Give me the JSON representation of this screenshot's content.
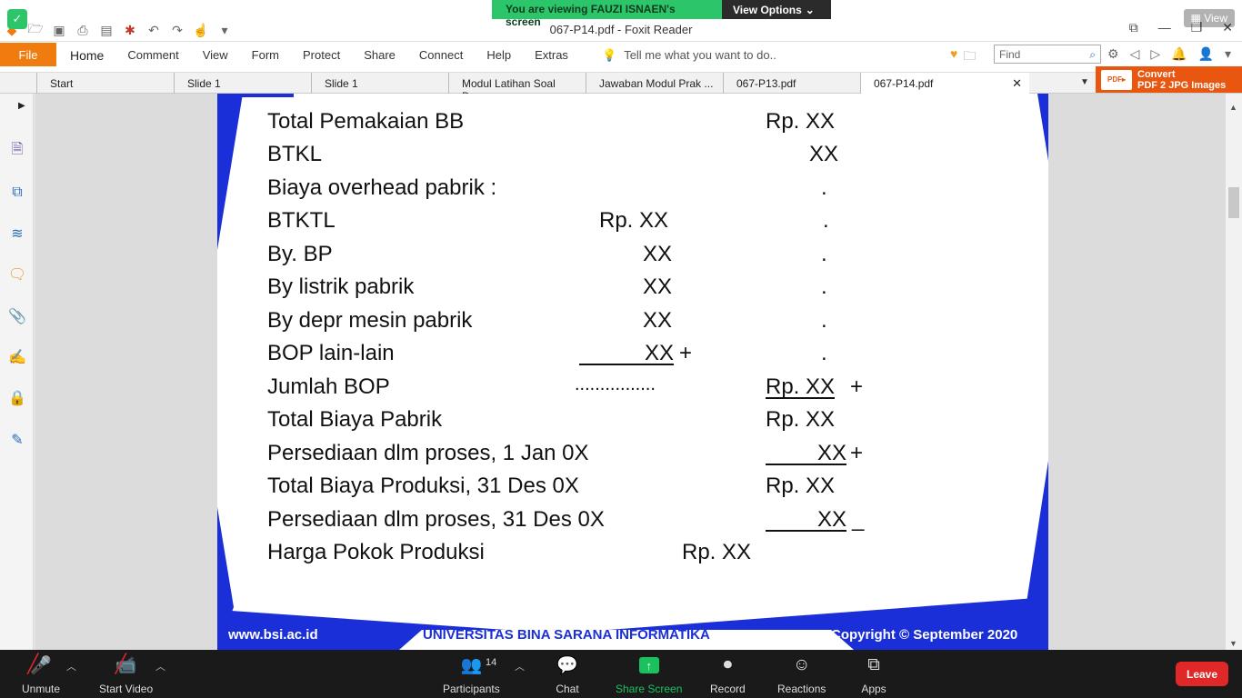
{
  "zoom": {
    "banner_viewing": "You are viewing FAUZI ISNAEN's screen",
    "view_options": "View Options",
    "view_top_right": "View",
    "participants_count": "14",
    "toolbar": {
      "unmute": "Unmute",
      "start_video": "Start Video",
      "participants": "Participants",
      "chat": "Chat",
      "share_screen": "Share Screen",
      "record": "Record",
      "reactions": "Reactions",
      "apps": "Apps",
      "leave": "Leave"
    }
  },
  "app": {
    "title": "067-P14.pdf - Foxit Reader"
  },
  "ribbon": {
    "file": "File",
    "tabs": [
      "Home",
      "Comment",
      "View",
      "Form",
      "Protect",
      "Share",
      "Connect",
      "Help",
      "Extras"
    ],
    "tell_me": "Tell me what you want to do..",
    "find_placeholder": "Find"
  },
  "doc_tabs": [
    "Start",
    "Slide 1",
    "Slide 1",
    "Modul Latihan Soal Da...",
    "Jawaban Modul Prak ...",
    "067-P13.pdf",
    "067-P14.pdf"
  ],
  "convert": {
    "line1": "Convert",
    "line2": "PDF 2 JPG Images"
  },
  "document": {
    "lines": [
      {
        "label": "Total Pemakaian BB",
        "mid": "",
        "right": "Rp. XX",
        "suffix": ""
      },
      {
        "label": "BTKL",
        "mid": "",
        "right": "XX",
        "suffix": ""
      },
      {
        "label": "Biaya overhead pabrik :",
        "mid": "",
        "right": ".",
        "suffix": ""
      },
      {
        "label": "BTKTL",
        "mid": "Rp. XX",
        "right": ".",
        "suffix": ""
      },
      {
        "label": "By. BP",
        "mid": "XX",
        "right": ".",
        "suffix": ""
      },
      {
        "label": "By listrik pabrik",
        "mid": "XX",
        "right": ".",
        "suffix": ""
      },
      {
        "label": "By depr mesin pabrik",
        "mid": "XX",
        "right": ".",
        "suffix": ""
      },
      {
        "label": "BOP lain-lain",
        "mid": "XX",
        "mid_suffix": "+",
        "right": ".",
        "suffix": ""
      },
      {
        "label": "Jumlah BOP",
        "mid": "................",
        "right": "Rp.  XX",
        "suffix": "+"
      },
      {
        "label": "Total Biaya Pabrik",
        "mid": "",
        "right": "Rp.  XX",
        "suffix": ""
      },
      {
        "label": "Persediaan dlm proses, 1 Jan 0X",
        "mid": "",
        "right": "XX",
        "suffix": "+"
      },
      {
        "label": "Total Biaya Produksi, 31 Des 0X",
        "mid": "",
        "right": "Rp.  XX",
        "suffix": ""
      },
      {
        "label": "Persediaan dlm proses, 31 Des 0X",
        "mid": "",
        "right": "XX",
        "suffix": "_"
      },
      {
        "label": "Harga Pokok Produksi",
        "mid": "Rp.  XX",
        "right": "",
        "suffix": ""
      }
    ],
    "footer": {
      "left": "www.bsi.ac.id",
      "center": "UNIVERSITAS BINA SARANA INFORMATIKA",
      "right": "Copyright © September 2020"
    }
  },
  "colors": {
    "accent": "#f07c10",
    "zoom_green": "#2dc56a",
    "slide_blue": "#1a2fd8",
    "leave_red": "#e02828"
  }
}
